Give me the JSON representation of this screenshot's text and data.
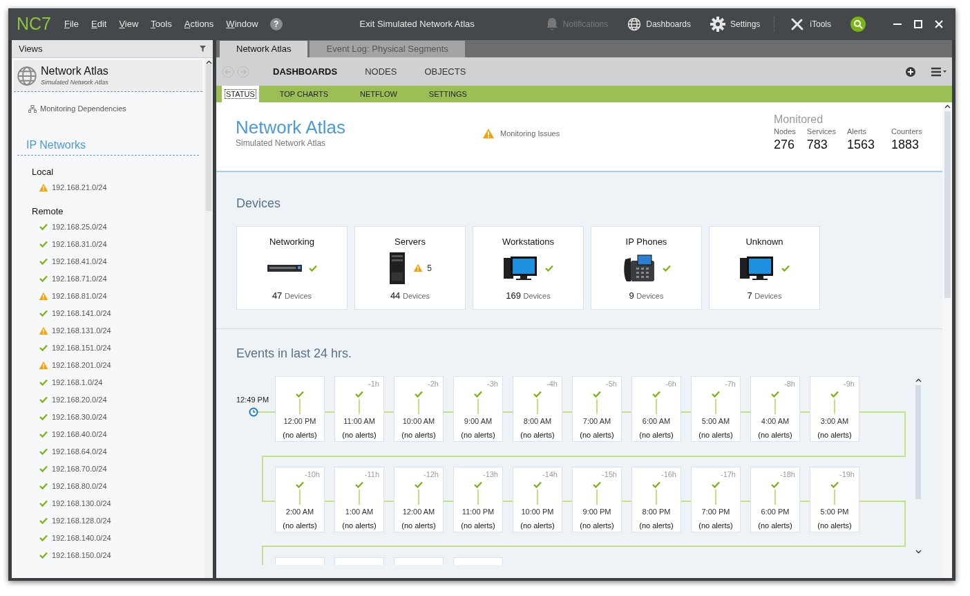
{
  "titlebar": {
    "logo": "NC7",
    "menu": [
      "File",
      "Edit",
      "View",
      "Tools",
      "Actions",
      "Window"
    ],
    "help": "?",
    "title": "Exit Simulated Network Atlas",
    "tools": [
      {
        "label": "Notifications",
        "disabled": true
      },
      {
        "label": "Dashboards",
        "disabled": false
      },
      {
        "label": "Settings",
        "disabled": false
      },
      {
        "label": "iTools",
        "disabled": false
      }
    ]
  },
  "views": {
    "title": "Views",
    "atlas": {
      "title": "Network Atlas",
      "subtitle": "Simulated Network Atlas"
    },
    "link": "Monitoring Dependencies",
    "section": "IP Networks",
    "groups": [
      {
        "name": "Local",
        "networks": [
          {
            "address": "192.168.21.0/24",
            "kind": "warning"
          }
        ]
      },
      {
        "name": "Remote",
        "networks": [
          {
            "address": "192.168.25.0/24",
            "kind": "ok"
          },
          {
            "address": "192.168.31.0/24",
            "kind": "ok"
          },
          {
            "address": "192.168.41.0/24",
            "kind": "ok"
          },
          {
            "address": "192.168.71.0/24",
            "kind": "ok"
          },
          {
            "address": "192.168.81.0/24",
            "kind": "warning"
          },
          {
            "address": "192.168.141.0/24",
            "kind": "ok"
          },
          {
            "address": "192.168.131.0/24",
            "kind": "warning"
          },
          {
            "address": "192.168.151.0/24",
            "kind": "ok"
          },
          {
            "address": "192.168.201.0/24",
            "kind": "warning"
          },
          {
            "address": "192.168.1.0/24",
            "kind": "ok"
          },
          {
            "address": "192.168.20.0/24",
            "kind": "ok"
          },
          {
            "address": "192.168.30.0/24",
            "kind": "ok"
          },
          {
            "address": "192.168.40.0/24",
            "kind": "ok"
          },
          {
            "address": "192.168.64.0/24",
            "kind": "ok"
          },
          {
            "address": "192.168.70.0/24",
            "kind": "ok"
          },
          {
            "address": "192.168.80.0/24",
            "kind": "ok"
          },
          {
            "address": "192.168.130.0/24",
            "kind": "ok"
          },
          {
            "address": "192.168.128.0/24",
            "kind": "ok"
          },
          {
            "address": "192.168.140.0/24",
            "kind": "ok"
          },
          {
            "address": "192.168.150.0/24",
            "kind": "ok"
          }
        ]
      }
    ]
  },
  "tabs": [
    {
      "label": "Network Atlas",
      "selected": true
    },
    {
      "label": "Event Log: Physical Segments",
      "selected": false
    }
  ],
  "nav": [
    {
      "label": "DASHBOARDS",
      "selected": true
    },
    {
      "label": "NODES",
      "selected": false
    },
    {
      "label": "OBJECTS",
      "selected": false
    }
  ],
  "subtabs": [
    {
      "label": "STATUS",
      "selected": true
    },
    {
      "label": "TOP CHARTS",
      "selected": false
    },
    {
      "label": "NETFLOW",
      "selected": false
    },
    {
      "label": "SETTINGS",
      "selected": false
    }
  ],
  "header": {
    "title": "Network Atlas",
    "subtitle": "Simulated Network Atlas",
    "issue": "Monitoring Issues",
    "monitored": "Monitored",
    "stats": [
      {
        "label": "Nodes",
        "value": "276"
      },
      {
        "label": "Services",
        "value": "783"
      },
      {
        "label": "Alerts",
        "value": "1563"
      },
      {
        "label": "Counters",
        "value": "1883"
      }
    ]
  },
  "devices": {
    "heading": "Devices",
    "cards": [
      {
        "name": "Networking",
        "kind": "ok",
        "count": "47",
        "unit": "Devices"
      },
      {
        "name": "Servers",
        "kind": "warning",
        "alerts": "5",
        "count": "44",
        "unit": "Devices"
      },
      {
        "name": "Workstations",
        "kind": "ok",
        "count": "169",
        "unit": "Devices"
      },
      {
        "name": "IP Phones",
        "kind": "ok",
        "count": "9",
        "unit": "Devices"
      },
      {
        "name": "Unknown",
        "kind": "ok",
        "count": "7",
        "unit": "Devices"
      }
    ]
  },
  "events": {
    "heading": "Events in last 24 hrs.",
    "now": "12:49 PM",
    "slots": [
      {
        "time": "12:00 PM",
        "summary": "(no alerts)",
        "kind": "ok"
      },
      {
        "offset": "-1h",
        "time": "11:00 AM",
        "summary": "(no alerts)",
        "kind": "ok"
      },
      {
        "offset": "-2h",
        "time": "10:00 AM",
        "summary": "(no alerts)",
        "kind": "ok"
      },
      {
        "offset": "-3h",
        "time": "9:00 AM",
        "summary": "(no alerts)",
        "kind": "ok"
      },
      {
        "offset": "-4h",
        "time": "8:00 AM",
        "summary": "(no alerts)",
        "kind": "ok"
      },
      {
        "offset": "-5h",
        "time": "7:00 AM",
        "summary": "(no alerts)",
        "kind": "ok"
      },
      {
        "offset": "-6h",
        "time": "6:00 AM",
        "summary": "(no alerts)",
        "kind": "ok"
      },
      {
        "offset": "-7h",
        "time": "5:00 AM",
        "summary": "(no alerts)",
        "kind": "ok"
      },
      {
        "offset": "-8h",
        "time": "4:00 AM",
        "summary": "(no alerts)",
        "kind": "ok"
      },
      {
        "offset": "-9h",
        "time": "3:00 AM",
        "summary": "(no alerts)",
        "kind": "ok"
      },
      {
        "offset": "-10h",
        "time": "2:00 AM",
        "summary": "(no alerts)",
        "kind": "ok"
      },
      {
        "offset": "-11h",
        "time": "1:00 AM",
        "summary": "(no alerts)",
        "kind": "ok"
      },
      {
        "offset": "-12h",
        "time": "12:00 AM",
        "summary": "(no alerts)",
        "kind": "ok"
      },
      {
        "offset": "-13h",
        "time": "11:00 PM",
        "summary": "(no alerts)",
        "kind": "ok"
      },
      {
        "offset": "-14h",
        "time": "10:00 PM",
        "summary": "(no alerts)",
        "kind": "ok"
      },
      {
        "offset": "-15h",
        "time": "9:00 PM",
        "summary": "(no alerts)",
        "kind": "ok"
      },
      {
        "offset": "-16h",
        "time": "8:00 PM",
        "summary": "(no alerts)",
        "kind": "ok"
      },
      {
        "offset": "-17h",
        "time": "7:00 PM",
        "summary": "(no alerts)",
        "kind": "ok"
      },
      {
        "offset": "-18h",
        "time": "6:00 PM",
        "summary": "(no alerts)",
        "kind": "ok"
      },
      {
        "offset": "-19h",
        "time": "5:00 PM",
        "summary": "(no alerts)",
        "kind": "ok"
      }
    ]
  }
}
